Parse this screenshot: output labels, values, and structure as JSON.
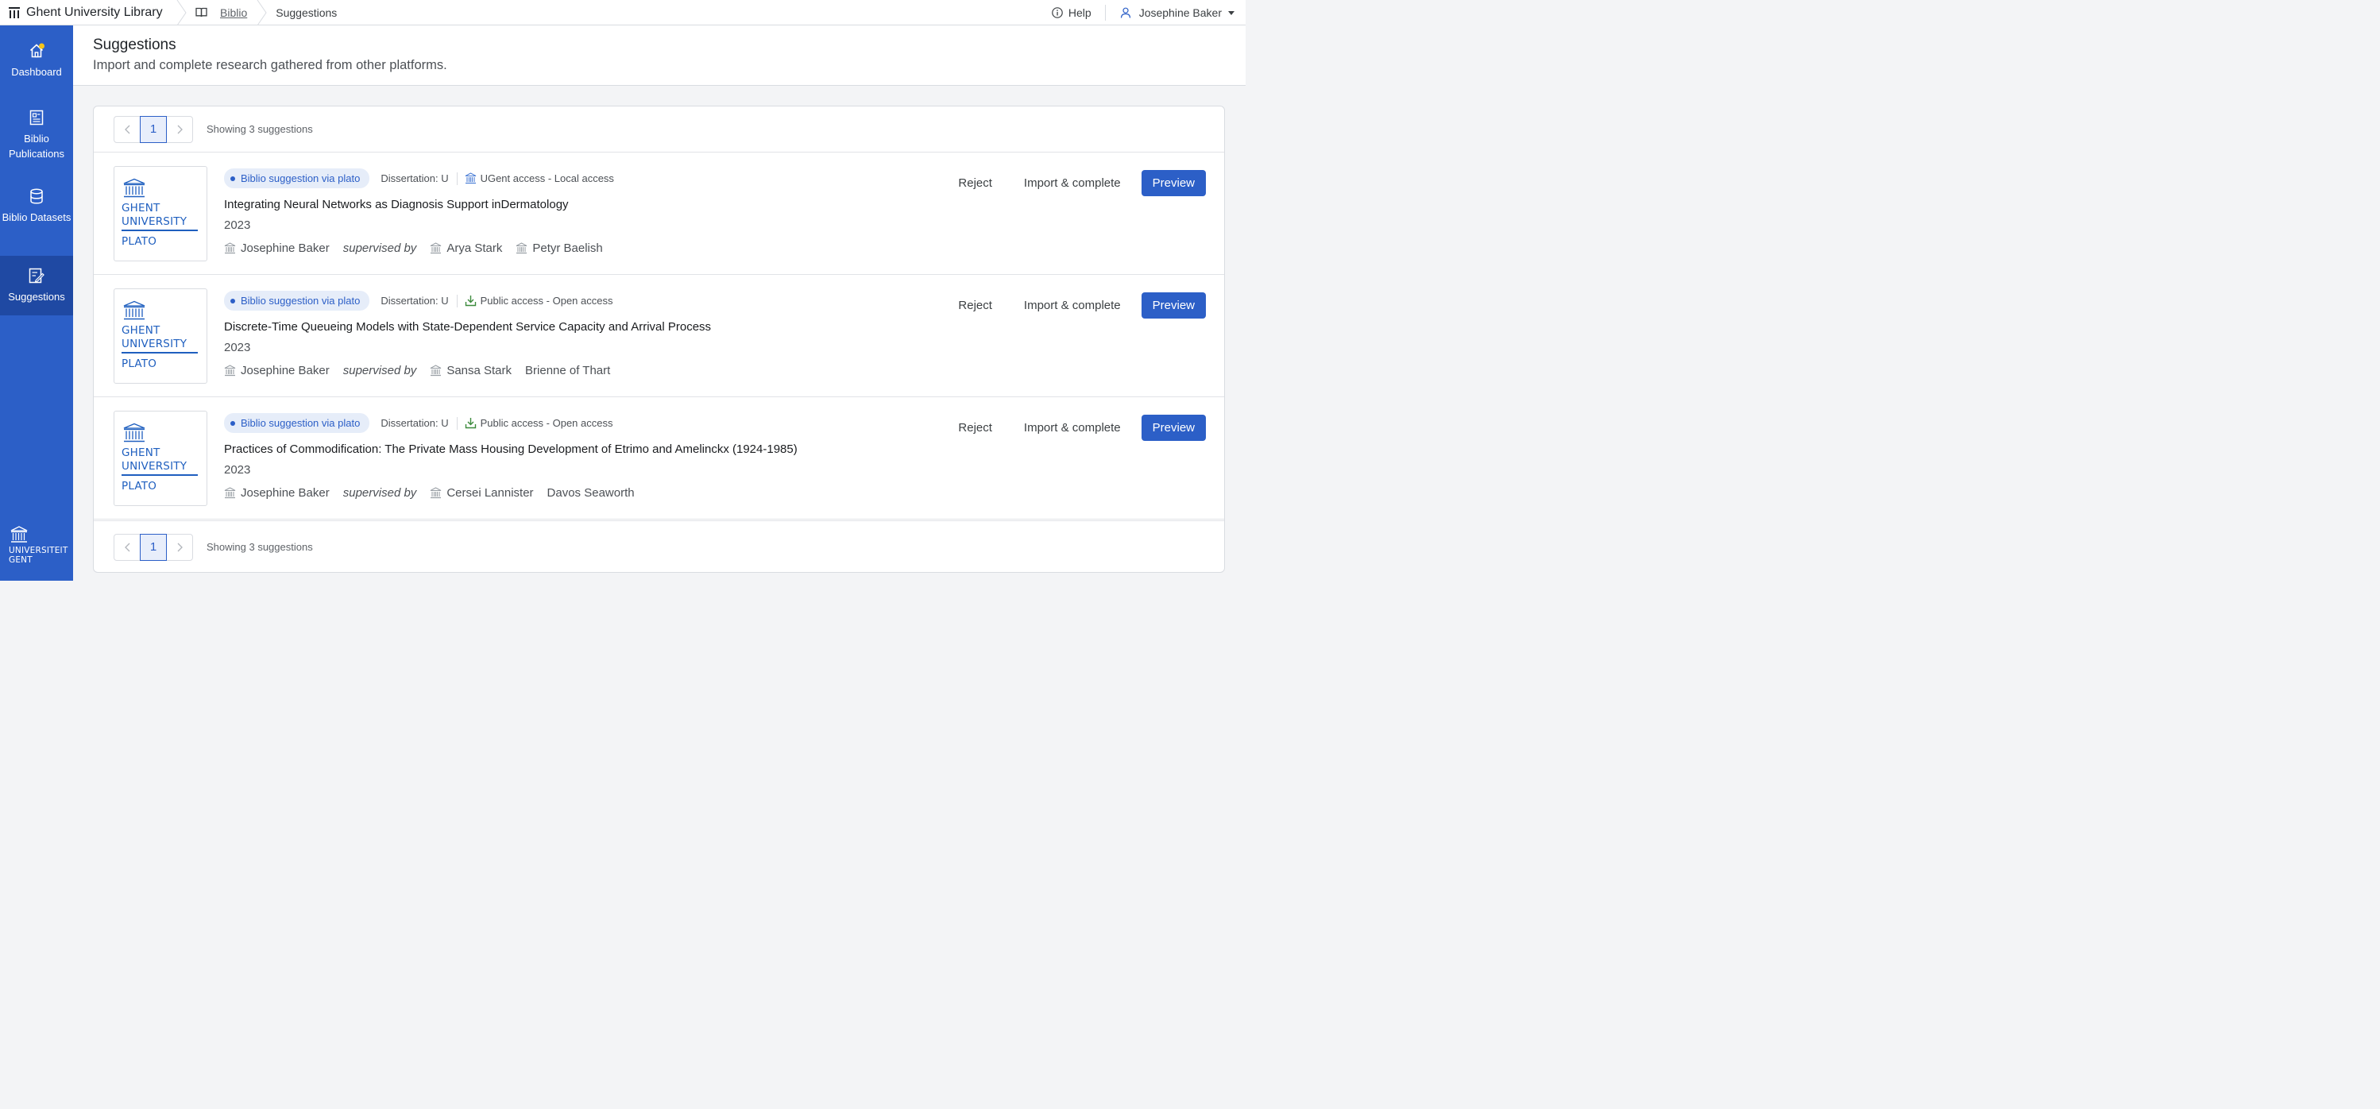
{
  "topbar": {
    "brand": "Ghent University Library",
    "crumb_biblio": "Biblio",
    "crumb_current": "Suggestions",
    "help": "Help",
    "user": "Josephine Baker"
  },
  "sidebar": {
    "items": [
      {
        "label": "Dashboard",
        "icon": "home-icon"
      },
      {
        "label": "Biblio Publications",
        "icon": "document-icon"
      },
      {
        "label": "Biblio Datasets",
        "icon": "database-icon"
      },
      {
        "label": "Suggestions",
        "icon": "edit-document-icon"
      }
    ],
    "footer_line1": "UNIVERSITEIT",
    "footer_line2": "GENT"
  },
  "header": {
    "title": "Suggestions",
    "subtitle": "Import and complete research gathered from other platforms."
  },
  "pagination": {
    "page": "1",
    "showing": "Showing 3 suggestions"
  },
  "logo": {
    "line1": "GHENT",
    "line2": "UNIVERSITY",
    "line3": "PLATO"
  },
  "labels": {
    "supervised_by": "supervised by",
    "reject": "Reject",
    "import": "Import & complete",
    "preview": "Preview"
  },
  "suggestions": [
    {
      "badge": "Biblio suggestion via plato",
      "type": "Dissertation: U",
      "access": "UGent access - Local access",
      "access_icon": "building-icon",
      "title": "Integrating Neural Networks as Diagnosis Support inDermatology",
      "year": "2023",
      "author": "Josephine Baker",
      "supervisors": [
        {
          "name": "Arya Stark",
          "ugent": true
        },
        {
          "name": "Petyr Baelish",
          "ugent": true
        }
      ]
    },
    {
      "badge": "Biblio suggestion via plato",
      "type": "Dissertation: U",
      "access": "Public access - Open access",
      "access_icon": "download-icon",
      "title": "Discrete-Time Queueing Models with State-Dependent Service Capacity and Arrival Process",
      "year": "2023",
      "author": "Josephine Baker",
      "supervisors": [
        {
          "name": "Sansa Stark",
          "ugent": true
        },
        {
          "name": "Brienne of Thart",
          "ugent": false
        }
      ]
    },
    {
      "badge": "Biblio suggestion via plato",
      "type": "Dissertation: U",
      "access": "Public access - Open access",
      "access_icon": "download-icon",
      "title": "Practices of Commodification: The Private Mass Housing Development of Etrimo and Amelinckx (1924-1985)",
      "year": "2023",
      "author": "Josephine Baker",
      "supervisors": [
        {
          "name": "Cersei Lannister",
          "ugent": true
        },
        {
          "name": "Davos Seaworth",
          "ugent": false
        }
      ]
    }
  ],
  "colors": {
    "brand_blue": "#2c5fc7",
    "sidebar_active": "#1f49a3",
    "badge_bg": "#e6edf9",
    "notification_dot": "#f5c518",
    "open_access_green": "#3c8a3c"
  }
}
